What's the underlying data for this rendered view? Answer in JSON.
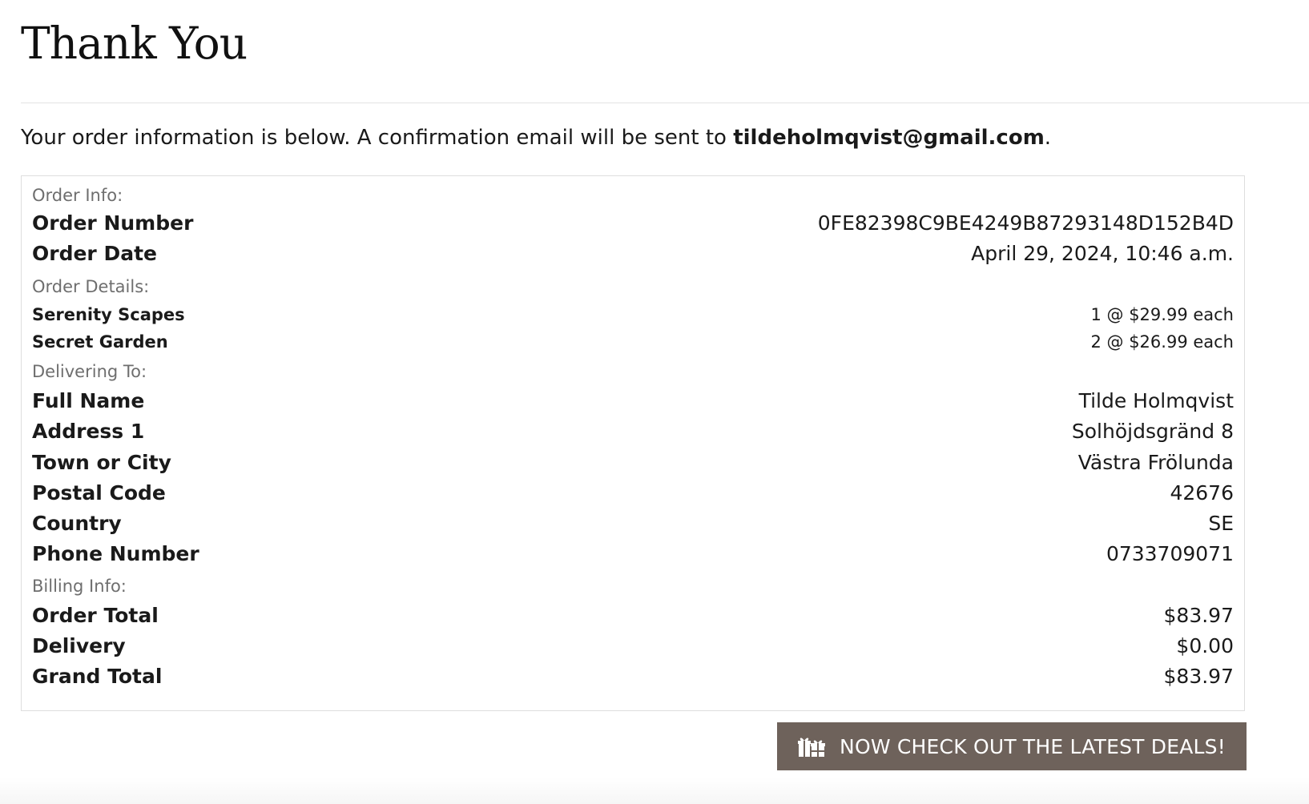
{
  "page": {
    "title": "Thank You",
    "intro_prefix": "Your order information is below. A confirmation email will be sent to ",
    "email": "tildeholmqvist@gmail.com",
    "intro_suffix": "."
  },
  "order_info": {
    "heading": "Order Info:",
    "order_number_label": "Order Number",
    "order_number": "0FE82398C9BE4249B87293148D152B4D",
    "order_date_label": "Order Date",
    "order_date": "April 29, 2024, 10:46 a.m."
  },
  "order_details": {
    "heading": "Order Details:",
    "items": [
      {
        "name": "Serenity Scapes",
        "qty_price": "1 @ $29.99 each"
      },
      {
        "name": "Secret Garden",
        "qty_price": "2 @ $26.99 each"
      }
    ]
  },
  "delivering_to": {
    "heading": "Delivering To:",
    "fields": [
      {
        "label": "Full Name",
        "value": "Tilde Holmqvist"
      },
      {
        "label": "Address 1",
        "value": "Solhöjdsgränd 8"
      },
      {
        "label": "Town or City",
        "value": "Västra Frölunda"
      },
      {
        "label": "Postal Code",
        "value": "42676"
      },
      {
        "label": "Country",
        "value": "SE"
      },
      {
        "label": "Phone Number",
        "value": "0733709071"
      }
    ]
  },
  "billing_info": {
    "heading": "Billing Info:",
    "fields": [
      {
        "label": "Order Total",
        "value": "$83.97"
      },
      {
        "label": "Delivery",
        "value": "$0.00"
      },
      {
        "label": "Grand Total",
        "value": "$83.97"
      }
    ]
  },
  "cta": {
    "label": "NOW CHECK OUT THE LATEST DEALS!",
    "icon": "gift-icon",
    "background": "#6e625b",
    "text_color": "#ffffff"
  }
}
